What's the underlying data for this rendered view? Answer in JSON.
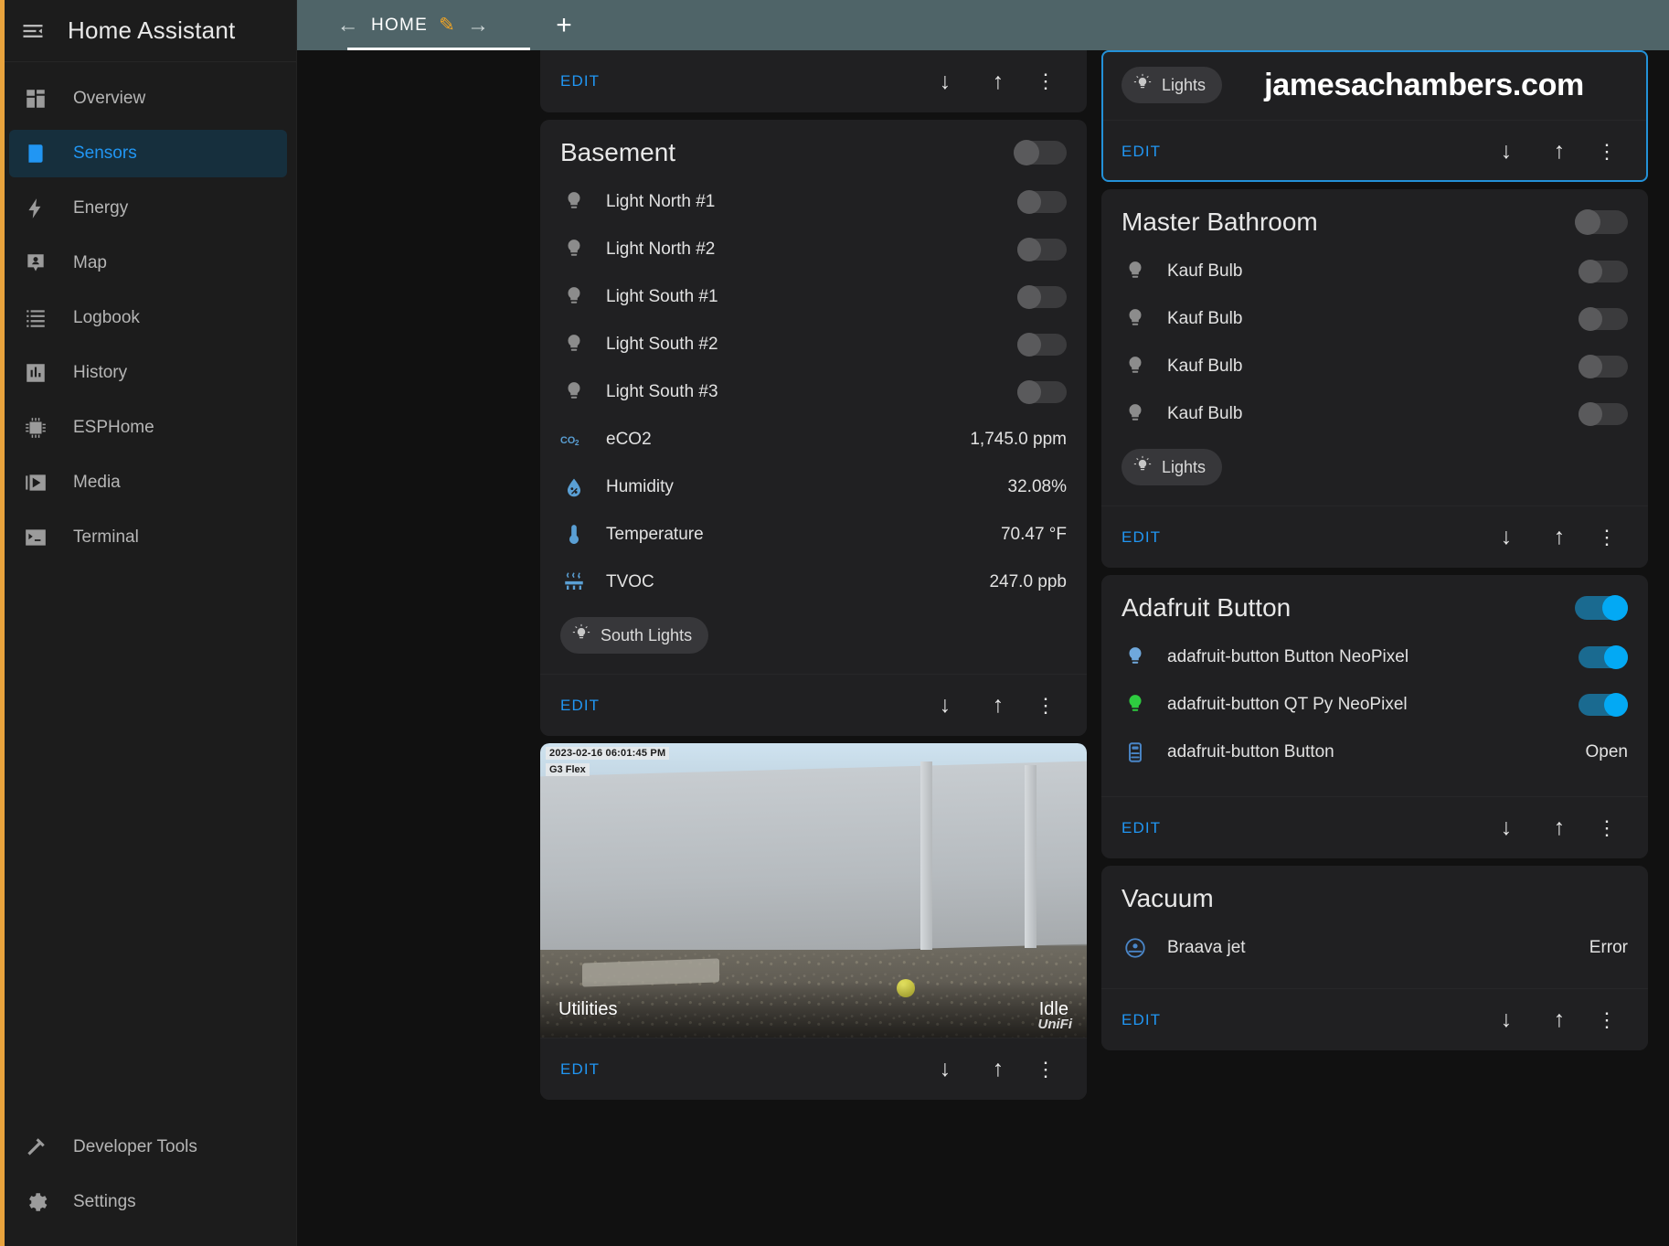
{
  "app": {
    "title": "Home Assistant",
    "menu_icon": "menu-collapse-icon"
  },
  "sidebar": {
    "items": [
      {
        "label": "Overview",
        "icon": "view-dashboard-icon",
        "active": false
      },
      {
        "label": "Sensors",
        "icon": "sensors-icon",
        "active": true
      },
      {
        "label": "Energy",
        "icon": "lightning-bolt-icon",
        "active": false
      },
      {
        "label": "Map",
        "icon": "map-marker-account-icon",
        "active": false
      },
      {
        "label": "Logbook",
        "icon": "format-list-bulleted-icon",
        "active": false
      },
      {
        "label": "History",
        "icon": "chart-box-icon",
        "active": false
      },
      {
        "label": "ESPHome",
        "icon": "chip-icon",
        "active": false
      },
      {
        "label": "Media",
        "icon": "play-box-multiple-icon",
        "active": false
      },
      {
        "label": "Terminal",
        "icon": "console-icon",
        "active": false
      }
    ],
    "bottom_items": [
      {
        "label": "Developer Tools",
        "icon": "hammer-icon"
      },
      {
        "label": "Settings",
        "icon": "cog-icon"
      }
    ]
  },
  "topbar": {
    "back_icon": "arrow-left-icon",
    "forward_icon": "arrow-right-icon",
    "tab_label": "HOME",
    "edit_pencil_icon": "pencil-icon",
    "add_tab_icon": "plus-icon"
  },
  "common": {
    "edit_label": "EDIT",
    "move_down_icon": "arrow-down-icon",
    "move_up_icon": "arrow-up-icon",
    "more_icon": "dots-vertical-icon"
  },
  "colors": {
    "accent_blue": "#2196f3",
    "toggle_on": "#03a9f4",
    "topbar": "#4f6468",
    "card_bg": "#202022",
    "page_bg": "#111111",
    "selected_outline": "#2391d8",
    "sidebar_stripe": "#e8a33d",
    "bulb_green": "#2ecc40",
    "bulb_blue": "#6fa8dc"
  },
  "cards": {
    "top_partial": {
      "edit_label": "EDIT"
    },
    "basement": {
      "title": "Basement",
      "header_toggle": "off",
      "rows": [
        {
          "label": "Light North #1",
          "icon": "lightbulb-icon",
          "icon_color": "#8c8c8c",
          "control": "toggle",
          "state": "off"
        },
        {
          "label": "Light North #2",
          "icon": "lightbulb-icon",
          "icon_color": "#8c8c8c",
          "control": "toggle",
          "state": "off"
        },
        {
          "label": "Light South #1",
          "icon": "lightbulb-icon",
          "icon_color": "#8c8c8c",
          "control": "toggle",
          "state": "off"
        },
        {
          "label": "Light South #2",
          "icon": "lightbulb-icon",
          "icon_color": "#8c8c8c",
          "control": "toggle",
          "state": "off"
        },
        {
          "label": "Light South #3",
          "icon": "lightbulb-icon",
          "icon_color": "#8c8c8c",
          "control": "toggle",
          "state": "off"
        },
        {
          "label": "eCO2",
          "icon": "co2-icon",
          "icon_color": "#5a9fd4",
          "control": "value",
          "value": "1,745.0 ppm"
        },
        {
          "label": "Humidity",
          "icon": "water-percent-icon",
          "icon_color": "#5a9fd4",
          "control": "value",
          "value": "32.08%"
        },
        {
          "label": "Temperature",
          "icon": "thermometer-icon",
          "icon_color": "#5a9fd4",
          "control": "value",
          "value": "70.47 °F"
        },
        {
          "label": "TVOC",
          "icon": "air-filter-icon",
          "icon_color": "#5a9fd4",
          "control": "value",
          "value": "247.0 ppb"
        }
      ],
      "chip_label": "South Lights",
      "chip_icon": "lightbulb-on-icon"
    },
    "camera": {
      "timestamp": "2023-02-16 06:01:45 PM",
      "device": "G3 Flex",
      "name": "Utilities",
      "status": "Idle",
      "watermark": "UniFi"
    },
    "banner": {
      "chip_label": "Lights",
      "chip_icon": "lightbulb-on-icon",
      "text": "jamesachambers.com",
      "selected": true
    },
    "master_bathroom": {
      "title": "Master Bathroom",
      "header_toggle": "off",
      "rows": [
        {
          "label": "Kauf Bulb",
          "icon": "lightbulb-icon",
          "icon_color": "#8c8c8c",
          "control": "toggle",
          "state": "off"
        },
        {
          "label": "Kauf Bulb",
          "icon": "lightbulb-icon",
          "icon_color": "#8c8c8c",
          "control": "toggle",
          "state": "off"
        },
        {
          "label": "Kauf Bulb",
          "icon": "lightbulb-icon",
          "icon_color": "#8c8c8c",
          "control": "toggle",
          "state": "off"
        },
        {
          "label": "Kauf Bulb",
          "icon": "lightbulb-icon",
          "icon_color": "#8c8c8c",
          "control": "toggle",
          "state": "off"
        }
      ],
      "chip_label": "Lights",
      "chip_icon": "lightbulb-on-icon"
    },
    "adafruit_button": {
      "title": "Adafruit Button",
      "header_toggle": "on",
      "rows": [
        {
          "label": "adafruit-button Button NeoPixel",
          "icon": "lightbulb-icon",
          "icon_color": "#6fa8dc",
          "control": "toggle",
          "state": "on"
        },
        {
          "label": "adafruit-button QT Py NeoPixel",
          "icon": "lightbulb-icon",
          "icon_color": "#2ecc40",
          "control": "toggle",
          "state": "on"
        },
        {
          "label": "adafruit-button Button",
          "icon": "gesture-tap-button-icon",
          "icon_color": "#4a86c8",
          "control": "value",
          "value": "Open"
        }
      ]
    },
    "vacuum": {
      "title": "Vacuum",
      "rows": [
        {
          "label": "Braava jet",
          "icon": "robot-vacuum-icon",
          "icon_color": "#4a86c8",
          "control": "value",
          "value": "Error"
        }
      ]
    }
  }
}
